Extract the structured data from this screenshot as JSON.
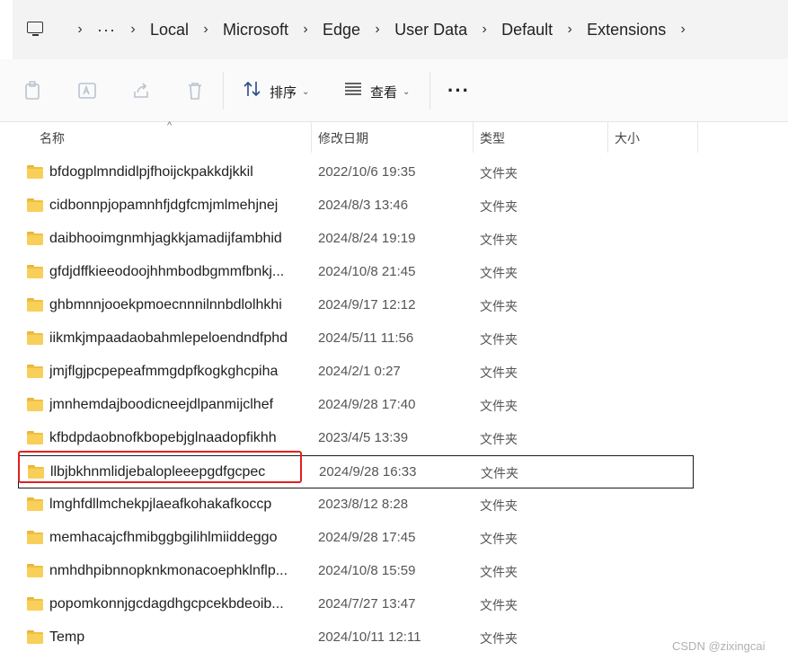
{
  "breadcrumb": {
    "overflow": "···",
    "items": [
      "Local",
      "Microsoft",
      "Edge",
      "User Data",
      "Default",
      "Extensions"
    ]
  },
  "toolbar": {
    "sort_label": "排序",
    "view_label": "查看",
    "more_label": "···"
  },
  "columns": {
    "name": "名称",
    "date": "修改日期",
    "type": "类型",
    "size": "大小"
  },
  "rows": [
    {
      "name": "bfdogplmndidlpjfhoijckpakkdjkkil",
      "date": "2022/10/6 19:35",
      "type": "文件夹"
    },
    {
      "name": "cidbonnpjopamnhfjdgfcmjmlmehjnej",
      "date": "2024/8/3 13:46",
      "type": "文件夹"
    },
    {
      "name": "daibhooimgnmhjagkkjamadijfambhid",
      "date": "2024/8/24 19:19",
      "type": "文件夹"
    },
    {
      "name": "gfdjdffkieeodoojhhmbodbgmmfbnkj...",
      "date": "2024/10/8 21:45",
      "type": "文件夹"
    },
    {
      "name": "ghbmnnjooekpmoecnnnilnnbdlolhkhi",
      "date": "2024/9/17 12:12",
      "type": "文件夹"
    },
    {
      "name": "iikmkjmpaadaobahmlepeloendndfphd",
      "date": "2024/5/11 11:56",
      "type": "文件夹"
    },
    {
      "name": "jmjflgjpcpepeafmmgdpfkogkghcpiha",
      "date": "2024/2/1 0:27",
      "type": "文件夹"
    },
    {
      "name": "jmnhemdajboodicneejdlpanmijclhef",
      "date": "2024/9/28 17:40",
      "type": "文件夹"
    },
    {
      "name": "kfbdpdaobnofkbopebjglnaadopfikhh",
      "date": "2023/4/5 13:39",
      "type": "文件夹"
    },
    {
      "name": "llbjbkhnmlidjebalopleeepgdfgcpec",
      "date": "2024/9/28 16:33",
      "type": "文件夹"
    },
    {
      "name": "lmghfdllmchekpjlaeafkohakafkoccp",
      "date": "2023/8/12 8:28",
      "type": "文件夹"
    },
    {
      "name": "memhacajcfhmibggbgilihlmiiddeggo",
      "date": "2024/9/28 17:45",
      "type": "文件夹"
    },
    {
      "name": "nmhdhpibnnopknkmonacoephklnflp...",
      "date": "2024/10/8 15:59",
      "type": "文件夹"
    },
    {
      "name": "popomkonnjgcdagdhgcpcekbdeoib...",
      "date": "2024/7/27 13:47",
      "type": "文件夹"
    },
    {
      "name": "Temp",
      "date": "2024/10/11 12:11",
      "type": "文件夹"
    }
  ],
  "watermark": "CSDN @zixingcai"
}
